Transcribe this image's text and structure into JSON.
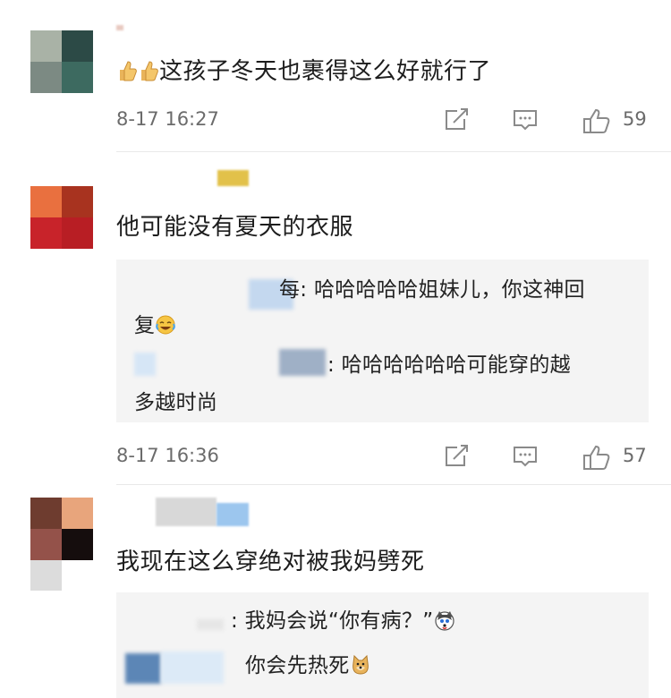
{
  "comments": [
    {
      "text": "这孩子冬天也裹得这么好就行了",
      "emoji_prefix": [
        "thumbs-up-icon",
        "thumbs-up-icon"
      ],
      "time": "8-17 16:27",
      "likes": "59"
    },
    {
      "text": "他可能没有夏天的衣服",
      "time": "8-17 16:36",
      "likes": "57",
      "replies": [
        {
          "line1": "每: 哈哈哈哈哈姐妹儿，你这神回",
          "line2": "复",
          "emoji": "laughing-crying-icon"
        },
        {
          "line1": ": 哈哈哈哈哈哈可能穿的越",
          "line2": "多越时尚"
        }
      ]
    },
    {
      "text": "我现在这么穿绝对被我妈劈死",
      "replies": [
        {
          "line1": ": 我妈会说“你有病？”",
          "emoji": "husky-face-icon"
        },
        {
          "line1": "你会先热死",
          "emoji": "doge-face-icon"
        }
      ]
    }
  ],
  "colors": {
    "meta_text": "#6b6b6b",
    "reply_bg": "#f4f4f4",
    "icon_stroke": "#8a8a8a"
  }
}
